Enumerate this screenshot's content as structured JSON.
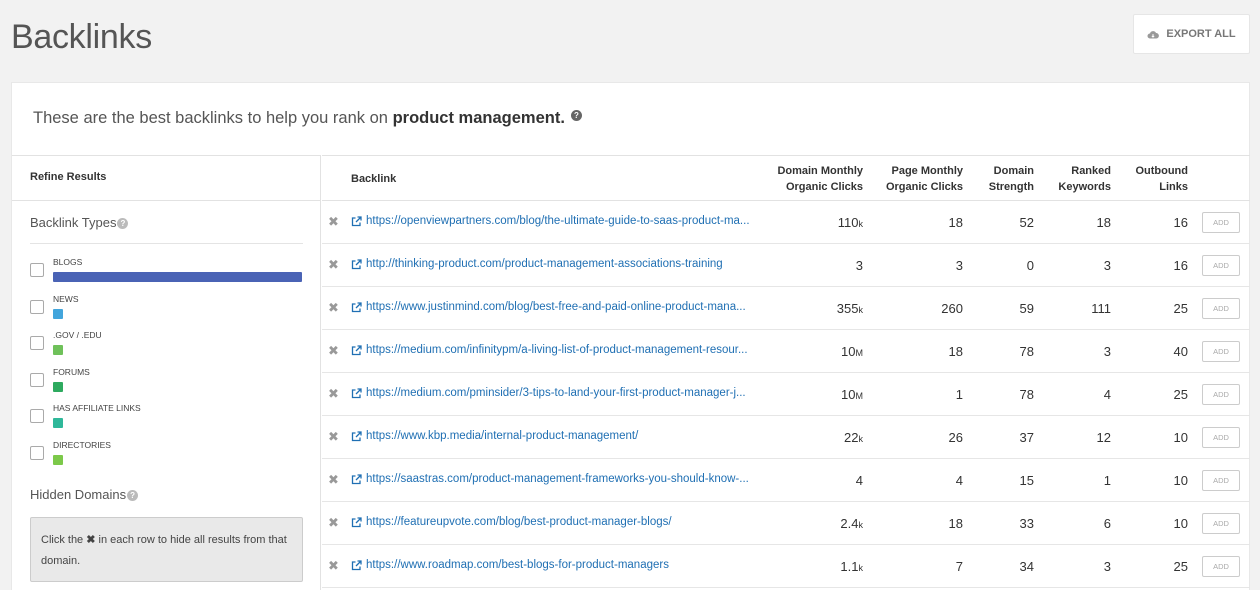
{
  "header": {
    "title": "Backlinks",
    "export_label": "EXPORT ALL"
  },
  "intro": {
    "prefix": "These are the best backlinks to help you rank on",
    "keyword": "product management."
  },
  "sidebar": {
    "refine_label": "Refine Results",
    "backlink_types_title": "Backlink Types",
    "filters": [
      {
        "label": "BLOGS",
        "color": "#4a63b5",
        "share": 1.0
      },
      {
        "label": "NEWS",
        "color": "#42a5dc",
        "share": 0.04
      },
      {
        "label": ".GOV / .EDU",
        "color": "#6fc15a",
        "share": 0.03
      },
      {
        "label": "FORUMS",
        "color": "#2eaa5f",
        "share": 0.03
      },
      {
        "label": "HAS AFFILIATE LINKS",
        "color": "#2fb89a",
        "share": 0.03
      },
      {
        "label": "DIRECTORIES",
        "color": "#7cc94a",
        "share": 0.03
      }
    ],
    "hidden_domains_title": "Hidden Domains",
    "hidden_hint_prefix": "Click the",
    "hidden_hint_suffix": "in each row to hide all results from that domain."
  },
  "table": {
    "headers": {
      "backlink": "Backlink",
      "domain_clicks_1": "Domain Monthly",
      "domain_clicks_2": "Organic Clicks",
      "page_clicks_1": "Page Monthly",
      "page_clicks_2": "Organic Clicks",
      "strength_1": "Domain",
      "strength_2": "Strength",
      "ranked_1": "Ranked",
      "ranked_2": "Keywords",
      "outbound_1": "Outbound",
      "outbound_2": "Links"
    },
    "add_label": "ADD",
    "rows": [
      {
        "url": "https://openviewpartners.com/blog/the-ultimate-guide-to-saas-product-ma...",
        "domain_clicks": "110",
        "domain_suffix": "k",
        "page_clicks": "18",
        "strength": "52",
        "ranked": "18",
        "outbound": "16"
      },
      {
        "url": "http://thinking-product.com/product-management-associations-training",
        "domain_clicks": "3",
        "domain_suffix": "",
        "page_clicks": "3",
        "strength": "0",
        "ranked": "3",
        "outbound": "16"
      },
      {
        "url": "https://www.justinmind.com/blog/best-free-and-paid-online-product-mana...",
        "domain_clicks": "355",
        "domain_suffix": "k",
        "page_clicks": "260",
        "strength": "59",
        "ranked": "111",
        "outbound": "25"
      },
      {
        "url": "https://medium.com/infinitypm/a-living-list-of-product-management-resour...",
        "domain_clicks": "10",
        "domain_suffix": "M",
        "page_clicks": "18",
        "strength": "78",
        "ranked": "3",
        "outbound": "40"
      },
      {
        "url": "https://medium.com/pminsider/3-tips-to-land-your-first-product-manager-j...",
        "domain_clicks": "10",
        "domain_suffix": "M",
        "page_clicks": "1",
        "strength": "78",
        "ranked": "4",
        "outbound": "25"
      },
      {
        "url": "https://www.kbp.media/internal-product-management/",
        "domain_clicks": "22",
        "domain_suffix": "k",
        "page_clicks": "26",
        "strength": "37",
        "ranked": "12",
        "outbound": "10"
      },
      {
        "url": "https://saastras.com/product-management-frameworks-you-should-know-...",
        "domain_clicks": "4",
        "domain_suffix": "",
        "page_clicks": "4",
        "strength": "15",
        "ranked": "1",
        "outbound": "10"
      },
      {
        "url": "https://featureupvote.com/blog/best-product-manager-blogs/",
        "domain_clicks": "2.4",
        "domain_suffix": "k",
        "page_clicks": "18",
        "strength": "33",
        "ranked": "6",
        "outbound": "10"
      },
      {
        "url": "https://www.roadmap.com/best-blogs-for-product-managers",
        "domain_clicks": "1.1",
        "domain_suffix": "k",
        "page_clicks": "7",
        "strength": "34",
        "ranked": "3",
        "outbound": "25"
      }
    ]
  }
}
